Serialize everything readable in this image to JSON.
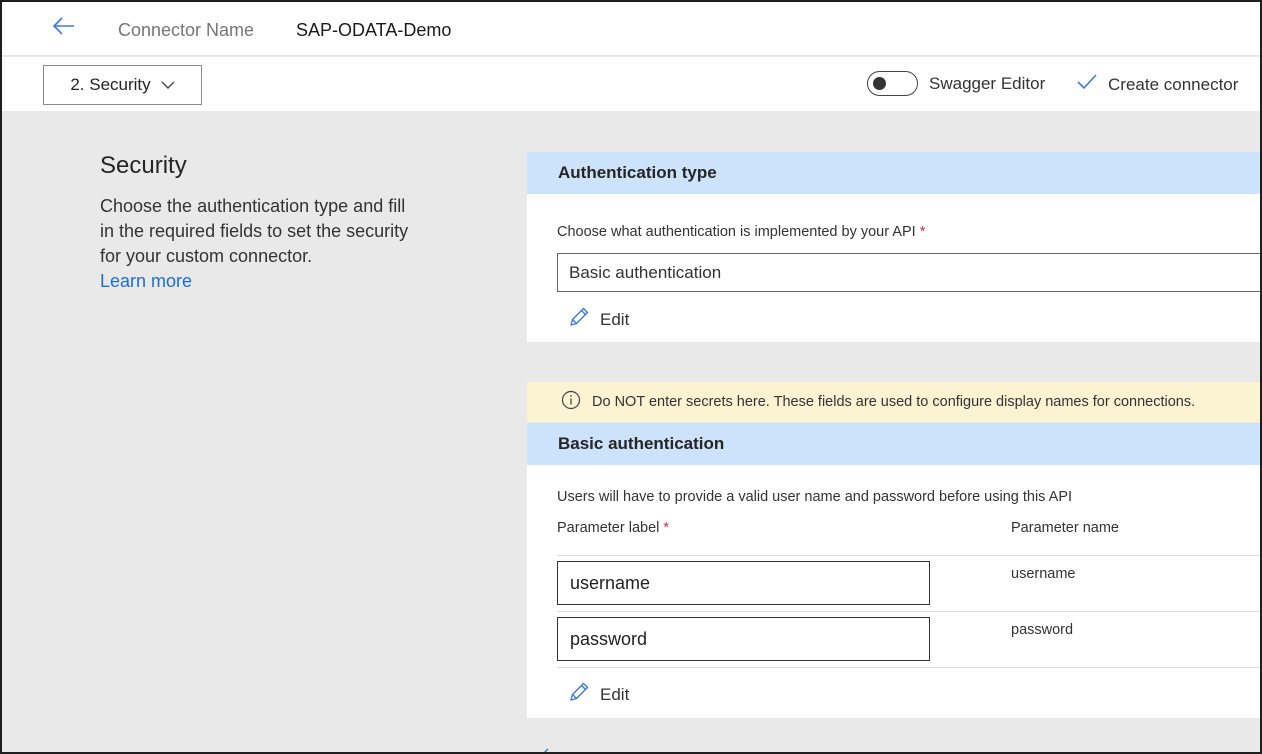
{
  "header": {
    "connector_label": "Connector Name",
    "connector_value": "SAP-ODATA-Demo"
  },
  "toolbar": {
    "step_label": "2. Security",
    "swagger_label": "Swagger Editor",
    "swagger_enabled": false,
    "create_label": "Create connector"
  },
  "intro": {
    "title": "Security",
    "description": "Choose the authentication type and fill in the required fields to set the security for your custom connector.",
    "learn_more": "Learn more"
  },
  "auth_type": {
    "header": "Authentication type",
    "question": "Choose what authentication is implemented by your API",
    "required_mark": "*",
    "selected": "Basic authentication",
    "edit_label": "Edit"
  },
  "warning": {
    "text": "Do NOT enter secrets here. These fields are used to configure display names for connections."
  },
  "basic_auth": {
    "header": "Basic authentication",
    "description": "Users will have to provide a valid user name and password before using this API",
    "col_label": "Parameter label",
    "col_label_required": "*",
    "col_name": "Parameter name",
    "params": [
      {
        "label": "username",
        "name": "username"
      },
      {
        "label": "password",
        "name": "password"
      }
    ],
    "edit_label": "Edit"
  },
  "colors": {
    "accent": "#1a6fd1",
    "header_band": "#cde3fc",
    "warning_band": "#fcf3d2",
    "required": "#c4314b",
    "page_bg": "#e9e9e9"
  },
  "icons": {
    "back": "back-arrow-icon",
    "dropdown": "chevron-down-icon",
    "check": "checkmark-icon",
    "edit": "pencil-icon",
    "info": "info-icon"
  }
}
